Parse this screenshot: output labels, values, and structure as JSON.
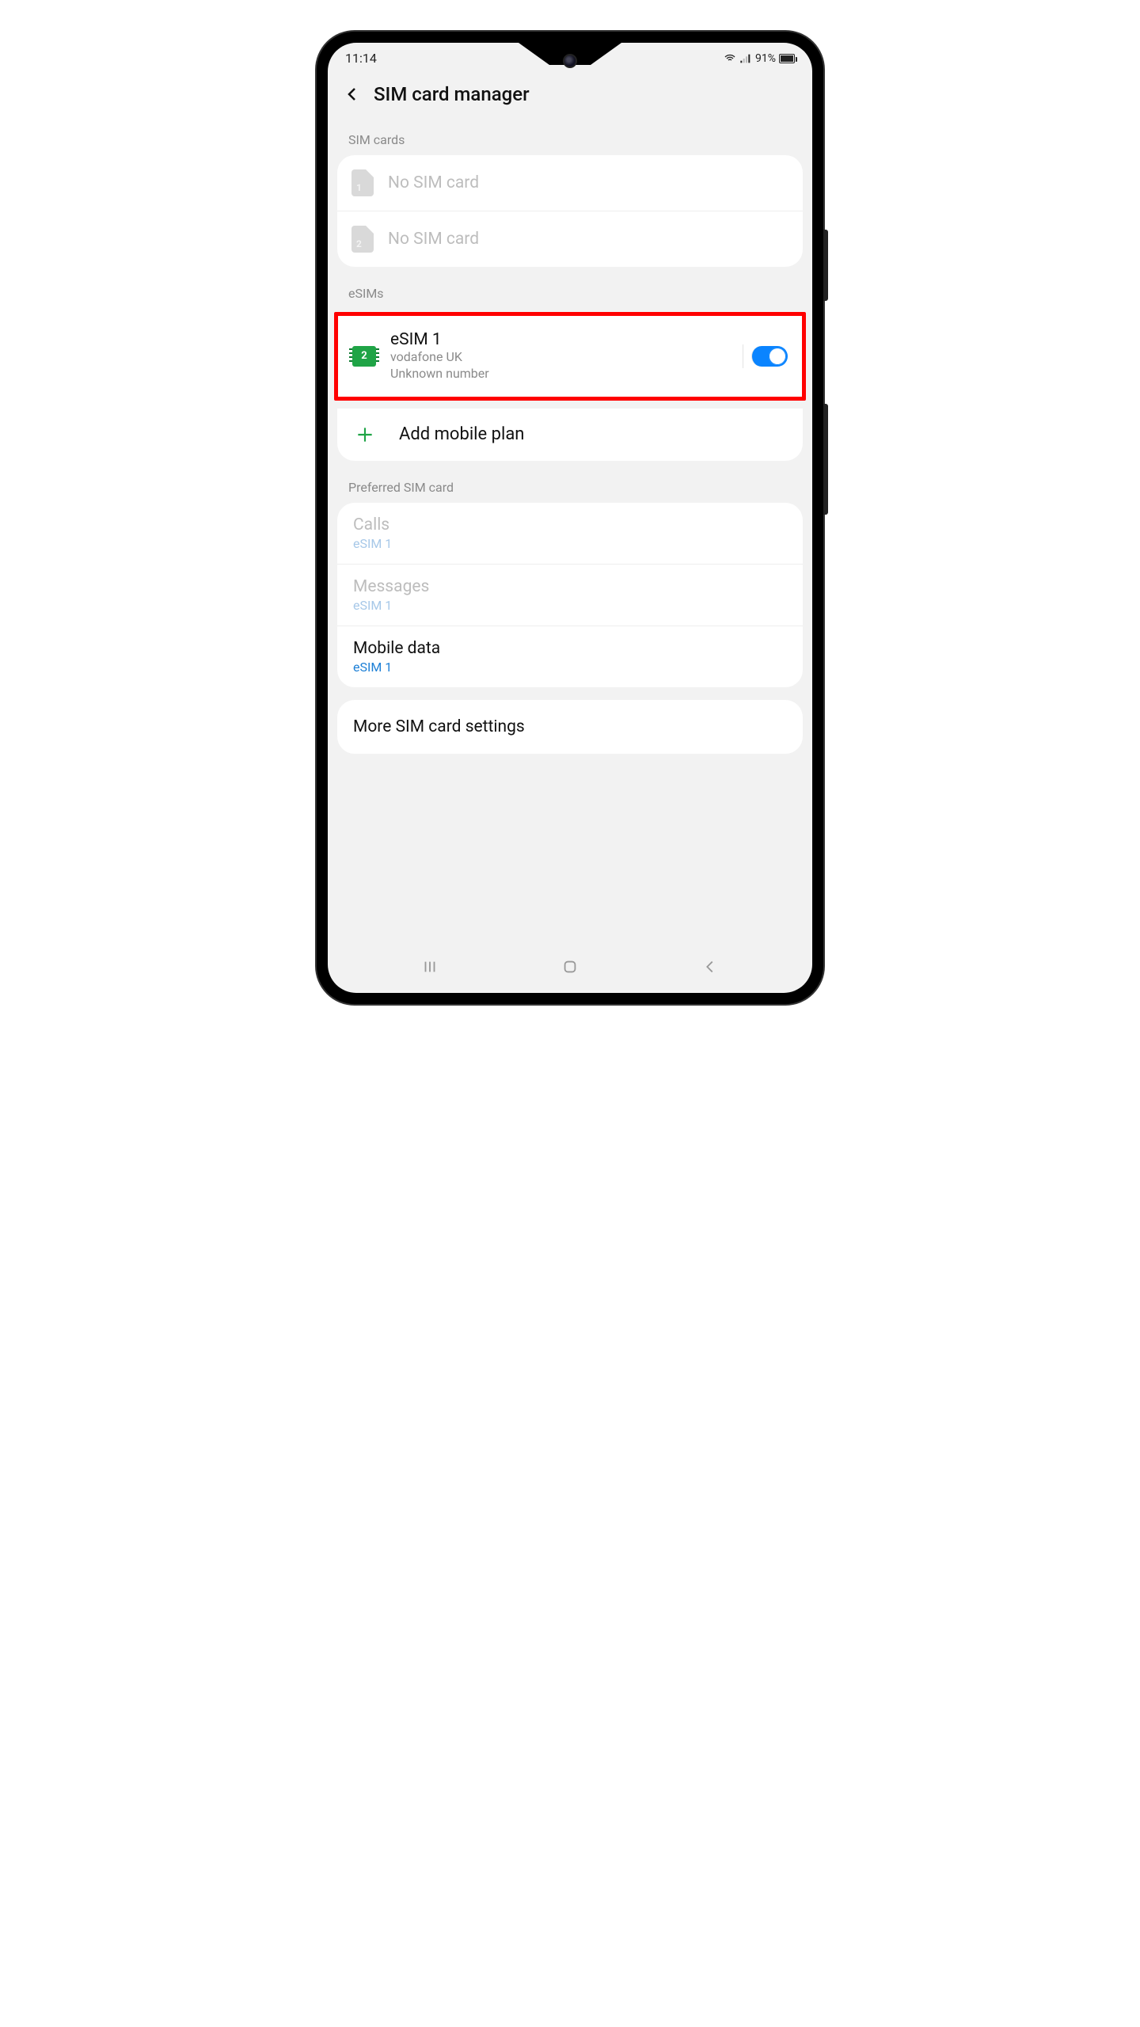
{
  "status": {
    "time": "11:14",
    "battery_pct": "91%"
  },
  "header": {
    "title": "SIM card manager"
  },
  "sections": {
    "sim_cards_label": "SIM cards",
    "esims_label": "eSIMs",
    "preferred_label": "Preferred SIM card"
  },
  "sim_slots": [
    {
      "slot_num": "1",
      "text": "No SIM card"
    },
    {
      "slot_num": "2",
      "text": "No SIM card"
    }
  ],
  "esim": {
    "chip_num": "2",
    "name": "eSIM 1",
    "carrier": "vodafone UK",
    "number": "Unknown number",
    "enabled": true
  },
  "add_plan_label": "Add mobile plan",
  "preferred": {
    "calls": {
      "label": "Calls",
      "value": "eSIM 1"
    },
    "messages": {
      "label": "Messages",
      "value": "eSIM 1"
    },
    "mobile_data": {
      "label": "Mobile data",
      "value": "eSIM 1"
    }
  },
  "more_settings_label": "More SIM card settings"
}
